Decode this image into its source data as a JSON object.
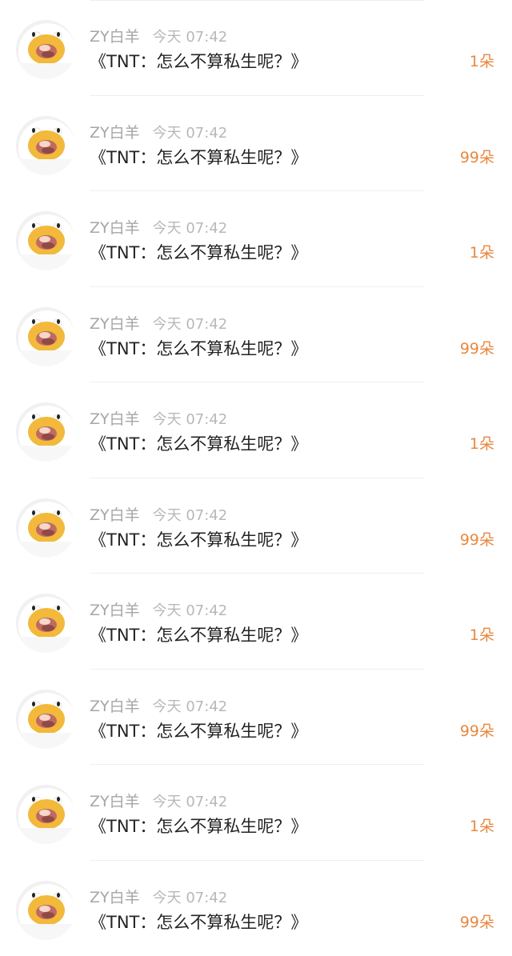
{
  "list": {
    "items": [
      {
        "username": "ZY白羊",
        "time": "今天 07:42",
        "title": "《TNT：怎么不算私生呢？》",
        "count": "1朵",
        "avatar_icon": "duck-costume-avatar-icon"
      },
      {
        "username": "ZY白羊",
        "time": "今天 07:42",
        "title": "《TNT：怎么不算私生呢？》",
        "count": "99朵",
        "avatar_icon": "duck-costume-avatar-icon"
      },
      {
        "username": "ZY白羊",
        "time": "今天 07:42",
        "title": "《TNT：怎么不算私生呢？》",
        "count": "1朵",
        "avatar_icon": "duck-costume-avatar-icon"
      },
      {
        "username": "ZY白羊",
        "time": "今天 07:42",
        "title": "《TNT：怎么不算私生呢？》",
        "count": "99朵",
        "avatar_icon": "duck-costume-avatar-icon"
      },
      {
        "username": "ZY白羊",
        "time": "今天 07:42",
        "title": "《TNT：怎么不算私生呢？》",
        "count": "1朵",
        "avatar_icon": "duck-costume-avatar-icon"
      },
      {
        "username": "ZY白羊",
        "time": "今天 07:42",
        "title": "《TNT：怎么不算私生呢？》",
        "count": "99朵",
        "avatar_icon": "duck-costume-avatar-icon"
      },
      {
        "username": "ZY白羊",
        "time": "今天 07:42",
        "title": "《TNT：怎么不算私生呢？》",
        "count": "1朵",
        "avatar_icon": "duck-costume-avatar-icon"
      },
      {
        "username": "ZY白羊",
        "time": "今天 07:42",
        "title": "《TNT：怎么不算私生呢？》",
        "count": "99朵",
        "avatar_icon": "duck-costume-avatar-icon"
      },
      {
        "username": "ZY白羊",
        "time": "今天 07:42",
        "title": "《TNT：怎么不算私生呢？》",
        "count": "1朵",
        "avatar_icon": "duck-costume-avatar-icon"
      },
      {
        "username": "ZY白羊",
        "time": "今天 07:42",
        "title": "《TNT：怎么不算私生呢？》",
        "count": "99朵",
        "avatar_icon": "duck-costume-avatar-icon"
      }
    ]
  },
  "colors": {
    "background": "#ffffff",
    "username": "#a6a6a6",
    "time": "#b8b8b8",
    "title": "#242424",
    "count_accent": "#e8883f",
    "divider": "#efefef"
  }
}
